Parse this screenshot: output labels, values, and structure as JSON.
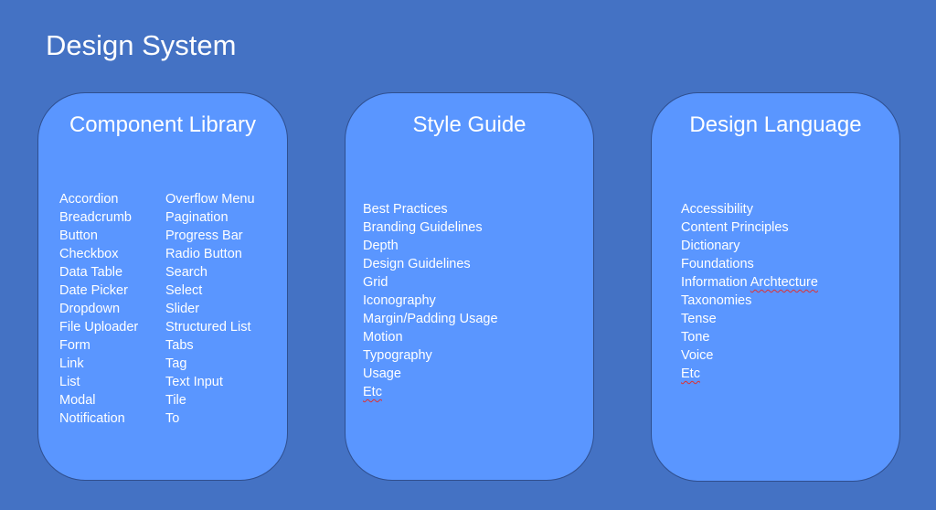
{
  "title": "Design System",
  "component_library": {
    "title": "Component Library",
    "column1": [
      "Accordion",
      "Breadcrumb",
      "Button",
      "Checkbox",
      "Data Table",
      "Date Picker",
      "Dropdown",
      "File Uploader",
      "Form",
      "Link",
      "List",
      "Modal",
      "Notification"
    ],
    "column2": [
      "Overflow Menu",
      "Pagination",
      "Progress Bar",
      "Radio Button",
      "Search",
      "Select",
      "Slider",
      "Structured List",
      "Tabs",
      "Tag",
      "Text Input",
      "Tile",
      "To"
    ]
  },
  "style_guide": {
    "title": "Style Guide",
    "items": [
      "Best Practices",
      "Branding Guidelines",
      "Depth",
      "Design Guidelines",
      "Grid",
      "Iconography",
      "Margin/Padding Usage",
      "Motion",
      "Typography",
      "Usage",
      "Etc"
    ]
  },
  "design_language": {
    "title": "Design Language",
    "items": [
      "Accessibility",
      "Content Principles",
      "Dictionary",
      "Foundations",
      "Information Archtecture",
      "Taxonomies",
      "Tense",
      "Tone",
      "Voice",
      "Etc"
    ]
  },
  "colors": {
    "background": "#4472c4",
    "card_fill": "#5a96ff",
    "card_border": "#2f4f8f",
    "text": "#ffffff",
    "spellcheck_underline": "#e03030"
  }
}
